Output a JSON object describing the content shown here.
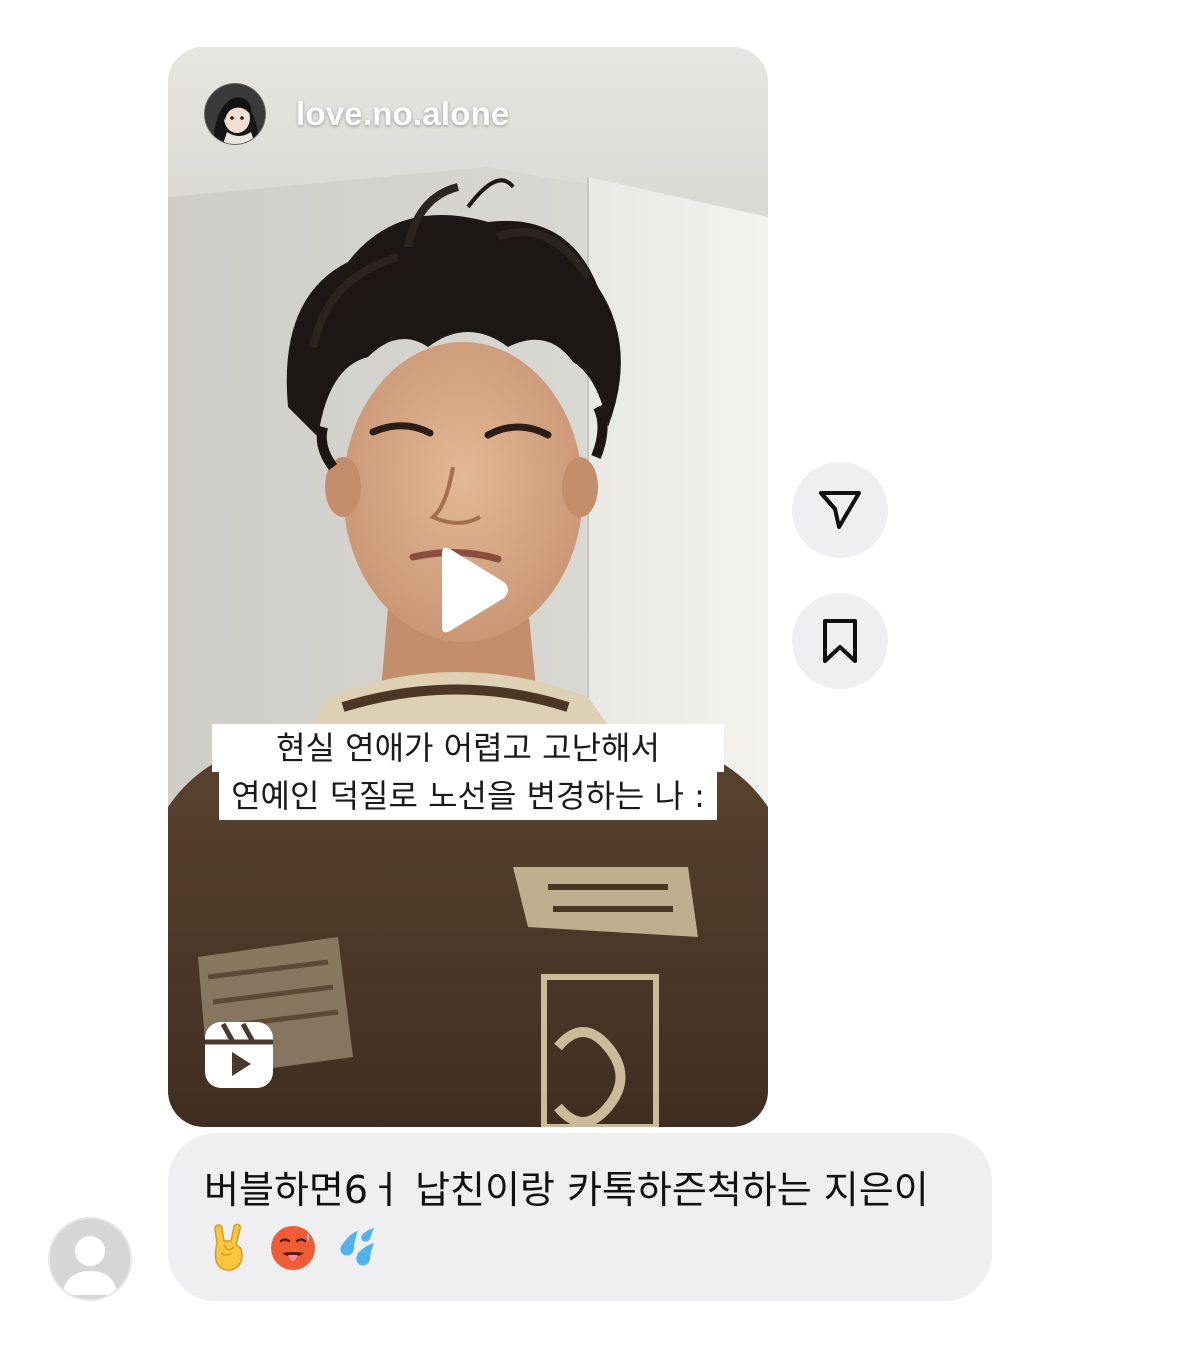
{
  "reel": {
    "username": "love.no.alone",
    "caption": {
      "line1": "현실 연애가 어렵고 고난해서",
      "line2": "연예인 덕질로 노선을 변경하는 나 :"
    }
  },
  "message": {
    "text": "버블하면6ㅓ 납친이랑 카톡하즌척하는 지은이",
    "emojis": [
      "🤘",
      "🥵",
      "💦"
    ]
  },
  "icons": {
    "reels": "reels-icon",
    "play": "play-icon",
    "share": "send-icon",
    "save": "bookmark-icon",
    "avatar": "default-avatar-icon"
  }
}
